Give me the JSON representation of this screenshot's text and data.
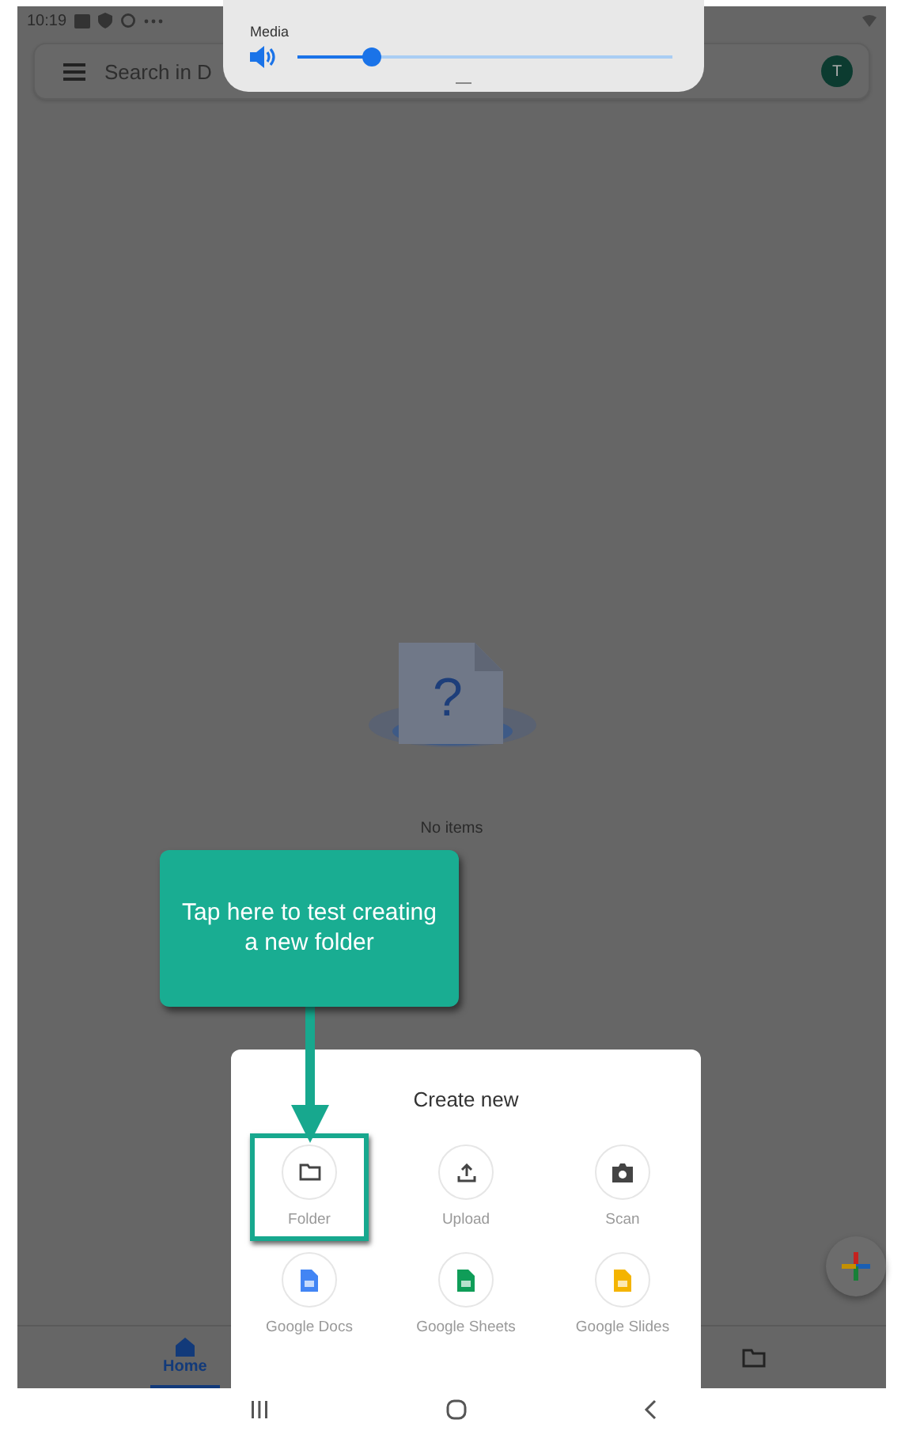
{
  "status_bar": {
    "time": "10:19"
  },
  "volume_panel": {
    "label": "Media",
    "level": 0.2
  },
  "search": {
    "placeholder": "Search in D"
  },
  "account": {
    "initial": "T"
  },
  "empty_state": {
    "glyph": "?",
    "message": "No items"
  },
  "bottom_nav": [
    {
      "kind": "home",
      "label": "Home",
      "selected": true
    },
    {
      "kind": "folder",
      "selected": false
    }
  ],
  "sheet": {
    "title": "Create new",
    "items": [
      {
        "kind": "folder",
        "label": "Folder",
        "highlighted": true
      },
      {
        "kind": "upload",
        "label": "Upload",
        "highlighted": false
      },
      {
        "kind": "scan",
        "label": "Scan",
        "highlighted": false
      },
      {
        "kind": "docs",
        "label": "Google Docs",
        "highlighted": false
      },
      {
        "kind": "sheets",
        "label": "Google Sheets",
        "highlighted": false
      },
      {
        "kind": "slides",
        "label": "Google Slides",
        "highlighted": false
      }
    ]
  },
  "callout": {
    "text": "Tap here to test creating a new folder"
  }
}
